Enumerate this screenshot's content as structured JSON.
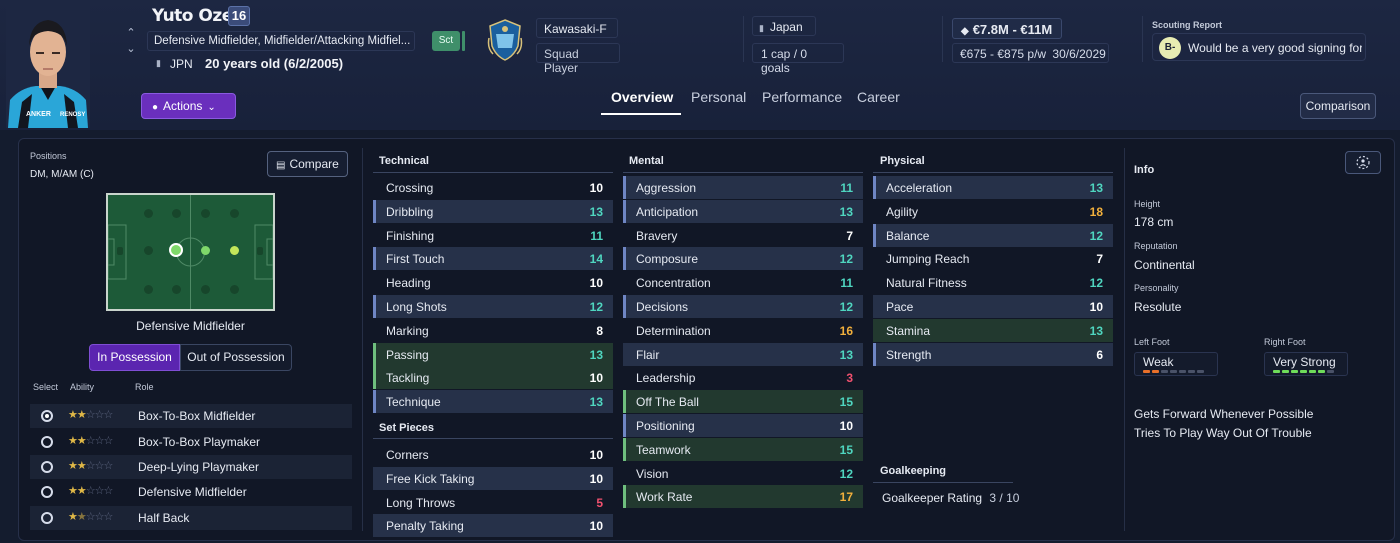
{
  "player": {
    "name": "Yuto Ozeki",
    "number": "16",
    "positions_text": "Defensive Midfielder, Midfielder/Attacking Midfiel...",
    "nationality": "JPN",
    "age_text": "20 years old (6/2/2005)",
    "scout_tag": "Sct"
  },
  "club": {
    "name": "Kawasaki-F",
    "status": "Squad Player"
  },
  "international": {
    "country": "Japan",
    "caps": "1 cap / 0 goals"
  },
  "contract": {
    "value": "€7.8M - €11M",
    "wage": "€675 - €875 p/w",
    "expiry": "30/6/2029"
  },
  "scouting": {
    "title": "Scouting Report",
    "grade": "B-",
    "summary": "Would be a very good signing for t..."
  },
  "actions_label": "Actions",
  "tabs": [
    "Overview",
    "Personal",
    "Performance",
    "Career"
  ],
  "comparison_label": "Comparison",
  "positions_panel": {
    "title": "Positions",
    "code": "DM, M/AM (C)",
    "compare_label": "Compare",
    "caption": "Defensive Midfielder",
    "toggle_on": "In Possession",
    "toggle_off": "Out of Possession",
    "headers": {
      "select": "Select",
      "ability": "Ability",
      "role": "Role"
    },
    "roles": [
      {
        "name": "Box-To-Box Midfielder",
        "stars": 2,
        "selected": true
      },
      {
        "name": "Box-To-Box Playmaker",
        "stars": 2,
        "selected": false
      },
      {
        "name": "Deep-Lying Playmaker",
        "stars": 2,
        "selected": false
      },
      {
        "name": "Defensive Midfielder",
        "stars": 2,
        "selected": false
      },
      {
        "name": "Half Back",
        "stars": 1.5,
        "selected": false
      }
    ]
  },
  "attributes": {
    "technical_title": "Technical",
    "technical": [
      {
        "name": "Crossing",
        "value": "10",
        "color": "#ffffff",
        "row": "plain",
        "bar": ""
      },
      {
        "name": "Dribbling",
        "value": "13",
        "color": "#4fd6c0",
        "row": "shade",
        "bar": "#6f86c4"
      },
      {
        "name": "Finishing",
        "value": "11",
        "color": "#4fd6c0",
        "row": "plain",
        "bar": ""
      },
      {
        "name": "First Touch",
        "value": "14",
        "color": "#4fd6c0",
        "row": "shade",
        "bar": "#6f86c4"
      },
      {
        "name": "Heading",
        "value": "10",
        "color": "#ffffff",
        "row": "plain",
        "bar": ""
      },
      {
        "name": "Long Shots",
        "value": "12",
        "color": "#4fd6c0",
        "row": "shade",
        "bar": "#6f86c4"
      },
      {
        "name": "Marking",
        "value": "8",
        "color": "#ffffff",
        "row": "plain",
        "bar": ""
      },
      {
        "name": "Passing",
        "value": "13",
        "color": "#4fd6c0",
        "row": "hl",
        "bar": "#6fbf7e"
      },
      {
        "name": "Tackling",
        "value": "10",
        "color": "#ffffff",
        "row": "hl",
        "bar": "#6fbf7e"
      },
      {
        "name": "Technique",
        "value": "13",
        "color": "#4fd6c0",
        "row": "shade",
        "bar": "#6f86c4"
      }
    ],
    "set_pieces_title": "Set Pieces",
    "set_pieces": [
      {
        "name": "Corners",
        "value": "10",
        "color": "#ffffff",
        "row": "plain",
        "bar": ""
      },
      {
        "name": "Free Kick Taking",
        "value": "10",
        "color": "#ffffff",
        "row": "shade",
        "bar": ""
      },
      {
        "name": "Long Throws",
        "value": "5",
        "color": "#f0506e",
        "row": "plain",
        "bar": ""
      },
      {
        "name": "Penalty Taking",
        "value": "10",
        "color": "#ffffff",
        "row": "shade",
        "bar": ""
      }
    ],
    "mental_title": "Mental",
    "mental": [
      {
        "name": "Aggression",
        "value": "11",
        "color": "#4fd6c0",
        "row": "shade",
        "bar": "#6f86c4"
      },
      {
        "name": "Anticipation",
        "value": "13",
        "color": "#4fd6c0",
        "row": "shade",
        "bar": "#6f86c4"
      },
      {
        "name": "Bravery",
        "value": "7",
        "color": "#ffffff",
        "row": "plain",
        "bar": ""
      },
      {
        "name": "Composure",
        "value": "12",
        "color": "#4fd6c0",
        "row": "shade",
        "bar": "#6f86c4"
      },
      {
        "name": "Concentration",
        "value": "11",
        "color": "#4fd6c0",
        "row": "plain",
        "bar": ""
      },
      {
        "name": "Decisions",
        "value": "12",
        "color": "#4fd6c0",
        "row": "shade",
        "bar": "#6f86c4"
      },
      {
        "name": "Determination",
        "value": "16",
        "color": "#f2b03c",
        "row": "plain",
        "bar": ""
      },
      {
        "name": "Flair",
        "value": "13",
        "color": "#4fd6c0",
        "row": "shade",
        "bar": ""
      },
      {
        "name": "Leadership",
        "value": "3",
        "color": "#f0506e",
        "row": "plain",
        "bar": ""
      },
      {
        "name": "Off The Ball",
        "value": "15",
        "color": "#4fd6c0",
        "row": "hl",
        "bar": "#6fbf7e"
      },
      {
        "name": "Positioning",
        "value": "10",
        "color": "#ffffff",
        "row": "shade",
        "bar": "#6f86c4"
      },
      {
        "name": "Teamwork",
        "value": "15",
        "color": "#4fd6c0",
        "row": "hl",
        "bar": "#6fbf7e"
      },
      {
        "name": "Vision",
        "value": "12",
        "color": "#4fd6c0",
        "row": "plain",
        "bar": ""
      },
      {
        "name": "Work Rate",
        "value": "17",
        "color": "#f2b03c",
        "row": "hl",
        "bar": "#6fbf7e"
      }
    ],
    "physical_title": "Physical",
    "physical": [
      {
        "name": "Acceleration",
        "value": "13",
        "color": "#4fd6c0",
        "row": "shade",
        "bar": "#6f86c4"
      },
      {
        "name": "Agility",
        "value": "18",
        "color": "#f2b03c",
        "row": "plain",
        "bar": ""
      },
      {
        "name": "Balance",
        "value": "12",
        "color": "#4fd6c0",
        "row": "shade",
        "bar": "#6f86c4"
      },
      {
        "name": "Jumping Reach",
        "value": "7",
        "color": "#ffffff",
        "row": "plain",
        "bar": ""
      },
      {
        "name": "Natural Fitness",
        "value": "12",
        "color": "#4fd6c0",
        "row": "plain",
        "bar": ""
      },
      {
        "name": "Pace",
        "value": "10",
        "color": "#ffffff",
        "row": "shade",
        "bar": ""
      },
      {
        "name": "Stamina",
        "value": "13",
        "color": "#4fd6c0",
        "row": "hl",
        "bar": ""
      },
      {
        "name": "Strength",
        "value": "6",
        "color": "#ffffff",
        "row": "shade",
        "bar": "#6f86c4"
      }
    ],
    "goalkeeping_title": "Goalkeeping",
    "goalkeeper_rating_label": "Goalkeeper Rating",
    "goalkeeper_rating": "3 / 10"
  },
  "info": {
    "title": "Info",
    "height_label": "Height",
    "height": "178 cm",
    "reputation_label": "Reputation",
    "reputation": "Continental",
    "personality_label": "Personality",
    "personality": "Resolute",
    "left_foot_label": "Left Foot",
    "left_foot": "Weak",
    "left_foot_level": 2,
    "right_foot_label": "Right Foot",
    "right_foot": "Very Strong",
    "right_foot_level": 6,
    "traits": [
      "Gets Forward Whenever Possible",
      "Tries To Play Way Out Of Trouble"
    ]
  },
  "colors": {
    "teal": "#4fd6c0",
    "gold": "#f2b03c",
    "red": "#f0506e",
    "accent_purple": "#6a2fbd"
  }
}
